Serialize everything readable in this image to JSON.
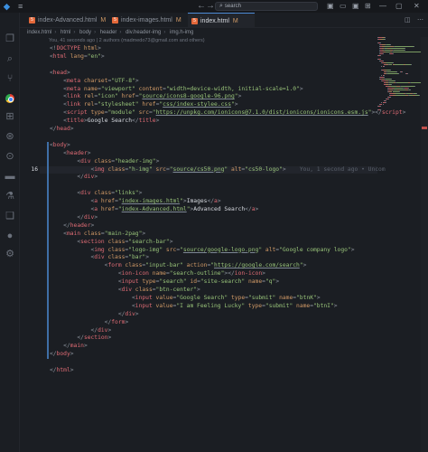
{
  "titlebar": {
    "menu_icon": "≡",
    "back": "←",
    "forward": "→",
    "search_icon": "⌕",
    "search_text": "search"
  },
  "tabs": [
    {
      "name": "index-Advanced.html",
      "status": "M",
      "active": false
    },
    {
      "name": "index-images.html",
      "status": "M",
      "active": false
    },
    {
      "name": "index.html",
      "status": "M",
      "active": true
    }
  ],
  "breadcrumb": [
    "index.html",
    "html",
    "body",
    "header",
    "div.header-img",
    "img.h-img"
  ],
  "blame": "You, 41 seconds ago | 2 authors (madmedo73@gmail.com and others)",
  "inline_blame": "You, 1 second ago • Uncom",
  "editor": {
    "active_line": 16,
    "lines": [
      [
        [
          "t-pun",
          "<!"
        ],
        [
          "t-tag",
          "DOCTYPE"
        ],
        [
          "t-attr",
          " html"
        ],
        [
          "t-pun",
          ">"
        ]
      ],
      [
        [
          "t-pun",
          "<"
        ],
        [
          "t-tag",
          "html"
        ],
        [
          "t-attr",
          " lang"
        ],
        [
          "t-pun",
          "="
        ],
        [
          "t-str",
          "\"en\""
        ],
        [
          "t-pun",
          ">"
        ]
      ],
      [],
      [
        [
          "t-pun",
          "<"
        ],
        [
          "t-tag",
          "head"
        ],
        [
          "t-pun",
          ">"
        ]
      ],
      [
        [
          "t-txt",
          "    "
        ],
        [
          "t-pun",
          "<"
        ],
        [
          "t-tag",
          "meta"
        ],
        [
          "t-attr",
          " charset"
        ],
        [
          "t-pun",
          "="
        ],
        [
          "t-str",
          "\"UTF-8\""
        ],
        [
          "t-pun",
          ">"
        ]
      ],
      [
        [
          "t-txt",
          "    "
        ],
        [
          "t-pun",
          "<"
        ],
        [
          "t-tag",
          "meta"
        ],
        [
          "t-attr",
          " name"
        ],
        [
          "t-pun",
          "="
        ],
        [
          "t-str",
          "\"viewport\""
        ],
        [
          "t-attr",
          " content"
        ],
        [
          "t-pun",
          "="
        ],
        [
          "t-str",
          "\"width=device-width, initial-scale=1.0\""
        ],
        [
          "t-pun",
          ">"
        ]
      ],
      [
        [
          "t-txt",
          "    "
        ],
        [
          "t-pun",
          "<"
        ],
        [
          "t-tag",
          "link"
        ],
        [
          "t-attr",
          " rel"
        ],
        [
          "t-pun",
          "="
        ],
        [
          "t-str",
          "\"icon\""
        ],
        [
          "t-attr",
          " href"
        ],
        [
          "t-pun",
          "="
        ],
        [
          "t-str",
          "\""
        ],
        [
          "t-str u",
          "source/icons8-google-96.png"
        ],
        [
          "t-str",
          "\""
        ],
        [
          "t-pun",
          ">"
        ]
      ],
      [
        [
          "t-txt",
          "    "
        ],
        [
          "t-pun",
          "<"
        ],
        [
          "t-tag",
          "link"
        ],
        [
          "t-attr",
          " rel"
        ],
        [
          "t-pun",
          "="
        ],
        [
          "t-str",
          "\"stylesheet\""
        ],
        [
          "t-attr",
          " href"
        ],
        [
          "t-pun",
          "="
        ],
        [
          "t-str",
          "\""
        ],
        [
          "t-str u",
          "css/index-stylee.css"
        ],
        [
          "t-str",
          "\""
        ],
        [
          "t-pun",
          ">"
        ]
      ],
      [
        [
          "t-txt",
          "    "
        ],
        [
          "t-pun",
          "<"
        ],
        [
          "t-tag",
          "script"
        ],
        [
          "t-attr",
          " type"
        ],
        [
          "t-pun",
          "="
        ],
        [
          "t-str",
          "\"module\""
        ],
        [
          "t-attr",
          " src"
        ],
        [
          "t-pun",
          "="
        ],
        [
          "t-str",
          "\""
        ],
        [
          "t-str u",
          "https://unpkg.com/ionicons@7.1.0/dist/ionicons/ionicons.esm.js"
        ],
        [
          "t-str",
          "\""
        ],
        [
          "t-pun",
          "></"
        ],
        [
          "t-tag",
          "script"
        ],
        [
          "t-pun",
          ">"
        ]
      ],
      [
        [
          "t-txt",
          "    "
        ],
        [
          "t-pun",
          "<"
        ],
        [
          "t-tag",
          "title"
        ],
        [
          "t-pun",
          ">"
        ],
        [
          "t-txt",
          "Google Search"
        ],
        [
          "t-pun",
          "</"
        ],
        [
          "t-tag",
          "title"
        ],
        [
          "t-pun",
          ">"
        ]
      ],
      [
        [
          "t-pun",
          "</"
        ],
        [
          "t-tag",
          "head"
        ],
        [
          "t-pun",
          ">"
        ]
      ],
      [],
      [
        [
          "t-pun",
          "<"
        ],
        [
          "t-tag",
          "body"
        ],
        [
          "t-pun",
          ">"
        ]
      ],
      [
        [
          "t-txt",
          "    "
        ],
        [
          "t-pun",
          "<"
        ],
        [
          "t-tag",
          "header"
        ],
        [
          "t-pun",
          ">"
        ]
      ],
      [
        [
          "t-txt",
          "        "
        ],
        [
          "t-pun",
          "<"
        ],
        [
          "t-tag",
          "div"
        ],
        [
          "t-attr",
          " class"
        ],
        [
          "t-pun",
          "="
        ],
        [
          "t-str",
          "\"header-img\""
        ],
        [
          "t-pun",
          ">"
        ]
      ],
      [
        [
          "t-txt",
          "            "
        ],
        [
          "t-pun",
          "<"
        ],
        [
          "t-tag",
          "img"
        ],
        [
          "t-attr",
          " class"
        ],
        [
          "t-pun",
          "="
        ],
        [
          "t-str",
          "\"h-img\""
        ],
        [
          "t-attr",
          " src"
        ],
        [
          "t-pun",
          "="
        ],
        [
          "t-str",
          "\""
        ],
        [
          "t-str u",
          "source/cs50.png"
        ],
        [
          "t-str",
          "\""
        ],
        [
          "t-attr",
          " alt"
        ],
        [
          "t-pun",
          "="
        ],
        [
          "t-str",
          "\"cs50-logo\""
        ],
        [
          "t-pun",
          ">"
        ],
        [
          "inline-blame",
          "    You, 1 second ago • Uncom"
        ]
      ],
      [
        [
          "t-txt",
          "        "
        ],
        [
          "t-pun",
          "</"
        ],
        [
          "t-tag",
          "div"
        ],
        [
          "t-pun",
          ">"
        ]
      ],
      [],
      [
        [
          "t-txt",
          "        "
        ],
        [
          "t-pun",
          "<"
        ],
        [
          "t-tag",
          "div"
        ],
        [
          "t-attr",
          " class"
        ],
        [
          "t-pun",
          "="
        ],
        [
          "t-str",
          "\"links\""
        ],
        [
          "t-pun",
          ">"
        ]
      ],
      [
        [
          "t-txt",
          "            "
        ],
        [
          "t-pun",
          "<"
        ],
        [
          "t-tag",
          "a"
        ],
        [
          "t-attr",
          " href"
        ],
        [
          "t-pun",
          "="
        ],
        [
          "t-str",
          "\""
        ],
        [
          "t-str u",
          "index-images.html"
        ],
        [
          "t-str",
          "\""
        ],
        [
          "t-pun",
          ">"
        ],
        [
          "t-txt",
          "Images"
        ],
        [
          "t-pun",
          "</"
        ],
        [
          "t-tag",
          "a"
        ],
        [
          "t-pun",
          ">"
        ]
      ],
      [
        [
          "t-txt",
          "            "
        ],
        [
          "t-pun",
          "<"
        ],
        [
          "t-tag",
          "a"
        ],
        [
          "t-attr",
          " href"
        ],
        [
          "t-pun",
          "="
        ],
        [
          "t-str",
          "\""
        ],
        [
          "t-str u",
          "index-Advanced.html"
        ],
        [
          "t-str",
          "\""
        ],
        [
          "t-pun",
          ">"
        ],
        [
          "t-txt",
          "Advanced Search"
        ],
        [
          "t-pun",
          "</"
        ],
        [
          "t-tag",
          "a"
        ],
        [
          "t-pun",
          ">"
        ]
      ],
      [
        [
          "t-txt",
          "        "
        ],
        [
          "t-pun",
          "</"
        ],
        [
          "t-tag",
          "div"
        ],
        [
          "t-pun",
          ">"
        ]
      ],
      [
        [
          "t-txt",
          "    "
        ],
        [
          "t-pun",
          "</"
        ],
        [
          "t-tag",
          "header"
        ],
        [
          "t-pun",
          ">"
        ]
      ],
      [
        [
          "t-txt",
          "    "
        ],
        [
          "t-pun",
          "<"
        ],
        [
          "t-tag",
          "main"
        ],
        [
          "t-attr",
          " class"
        ],
        [
          "t-pun",
          "="
        ],
        [
          "t-str",
          "\"main-2pag\""
        ],
        [
          "t-pun",
          ">"
        ]
      ],
      [
        [
          "t-txt",
          "        "
        ],
        [
          "t-pun",
          "<"
        ],
        [
          "t-tag",
          "section"
        ],
        [
          "t-attr",
          " class"
        ],
        [
          "t-pun",
          "="
        ],
        [
          "t-str",
          "\"search-bar\""
        ],
        [
          "t-pun",
          ">"
        ]
      ],
      [
        [
          "t-txt",
          "            "
        ],
        [
          "t-pun",
          "<"
        ],
        [
          "t-tag",
          "img"
        ],
        [
          "t-attr",
          " class"
        ],
        [
          "t-pun",
          "="
        ],
        [
          "t-str",
          "\"logo-img\""
        ],
        [
          "t-attr",
          " src"
        ],
        [
          "t-pun",
          "="
        ],
        [
          "t-str",
          "\""
        ],
        [
          "t-str u",
          "source/google-logo.png"
        ],
        [
          "t-str",
          "\""
        ],
        [
          "t-attr",
          " alt"
        ],
        [
          "t-pun",
          "="
        ],
        [
          "t-str",
          "\"Google company logo\""
        ],
        [
          "t-pun",
          ">"
        ]
      ],
      [
        [
          "t-txt",
          "            "
        ],
        [
          "t-pun",
          "<"
        ],
        [
          "t-tag",
          "div"
        ],
        [
          "t-attr",
          " class"
        ],
        [
          "t-pun",
          "="
        ],
        [
          "t-str",
          "\"bar\""
        ],
        [
          "t-pun",
          ">"
        ]
      ],
      [
        [
          "t-txt",
          "                "
        ],
        [
          "t-pun",
          "<"
        ],
        [
          "t-tag",
          "form"
        ],
        [
          "t-attr",
          " class"
        ],
        [
          "t-pun",
          "="
        ],
        [
          "t-str",
          "\"input-bar\""
        ],
        [
          "t-attr",
          " action"
        ],
        [
          "t-pun",
          "="
        ],
        [
          "t-str",
          "\""
        ],
        [
          "t-str u",
          "https://google.com/search"
        ],
        [
          "t-str",
          "\""
        ],
        [
          "t-pun",
          ">"
        ]
      ],
      [
        [
          "t-txt",
          "                    "
        ],
        [
          "t-pun",
          "<"
        ],
        [
          "t-tag",
          "ion-icon"
        ],
        [
          "t-attr",
          " name"
        ],
        [
          "t-pun",
          "="
        ],
        [
          "t-str",
          "\"search-outline\""
        ],
        [
          "t-pun",
          "></"
        ],
        [
          "t-tag",
          "ion-icon"
        ],
        [
          "t-pun",
          ">"
        ]
      ],
      [
        [
          "t-txt",
          "                    "
        ],
        [
          "t-pun",
          "<"
        ],
        [
          "t-tag",
          "input"
        ],
        [
          "t-attr",
          " type"
        ],
        [
          "t-pun",
          "="
        ],
        [
          "t-str",
          "\"search\""
        ],
        [
          "t-attr",
          " id"
        ],
        [
          "t-pun",
          "="
        ],
        [
          "t-str",
          "\"site-search\""
        ],
        [
          "t-attr",
          " name"
        ],
        [
          "t-pun",
          "="
        ],
        [
          "t-str",
          "\"q\""
        ],
        [
          "t-pun",
          ">"
        ]
      ],
      [
        [
          "t-txt",
          "                    "
        ],
        [
          "t-pun",
          "<"
        ],
        [
          "t-tag",
          "div"
        ],
        [
          "t-attr",
          " class"
        ],
        [
          "t-pun",
          "="
        ],
        [
          "t-str",
          "\"btn-center\""
        ],
        [
          "t-pun",
          ">"
        ]
      ],
      [
        [
          "t-txt",
          "                        "
        ],
        [
          "t-pun",
          "<"
        ],
        [
          "t-tag",
          "input"
        ],
        [
          "t-attr",
          " value"
        ],
        [
          "t-pun",
          "="
        ],
        [
          "t-str",
          "\"Google Search\""
        ],
        [
          "t-attr",
          " type"
        ],
        [
          "t-pun",
          "="
        ],
        [
          "t-str",
          "\"submit\""
        ],
        [
          "t-attr",
          " name"
        ],
        [
          "t-pun",
          "="
        ],
        [
          "t-str",
          "\"btnK\""
        ],
        [
          "t-pun",
          ">"
        ]
      ],
      [
        [
          "t-txt",
          "                        "
        ],
        [
          "t-pun",
          "<"
        ],
        [
          "t-tag",
          "input"
        ],
        [
          "t-attr",
          " value"
        ],
        [
          "t-pun",
          "="
        ],
        [
          "t-str",
          "\"I am Feeling Lucky\""
        ],
        [
          "t-attr",
          " type"
        ],
        [
          "t-pun",
          "="
        ],
        [
          "t-str",
          "\"submit\""
        ],
        [
          "t-attr",
          " name"
        ],
        [
          "t-pun",
          "="
        ],
        [
          "t-str",
          "\"btnI\""
        ],
        [
          "t-pun",
          ">"
        ]
      ],
      [
        [
          "t-txt",
          "                    "
        ],
        [
          "t-pun",
          "</"
        ],
        [
          "t-tag",
          "div"
        ],
        [
          "t-pun",
          ">"
        ]
      ],
      [
        [
          "t-txt",
          "                "
        ],
        [
          "t-pun",
          "</"
        ],
        [
          "t-tag",
          "form"
        ],
        [
          "t-pun",
          ">"
        ]
      ],
      [
        [
          "t-txt",
          "            "
        ],
        [
          "t-pun",
          "</"
        ],
        [
          "t-tag",
          "div"
        ],
        [
          "t-pun",
          ">"
        ]
      ],
      [
        [
          "t-txt",
          "        "
        ],
        [
          "t-pun",
          "</"
        ],
        [
          "t-tag",
          "section"
        ],
        [
          "t-pun",
          ">"
        ]
      ],
      [
        [
          "t-txt",
          "    "
        ],
        [
          "t-pun",
          "</"
        ],
        [
          "t-tag",
          "main"
        ],
        [
          "t-pun",
          ">"
        ]
      ],
      [
        [
          "t-pun",
          "</"
        ],
        [
          "t-tag",
          "body"
        ],
        [
          "t-pun",
          ">"
        ]
      ],
      [],
      [
        [
          "t-pun",
          "</"
        ],
        [
          "t-tag",
          "html"
        ],
        [
          "t-pun",
          ">"
        ]
      ]
    ]
  }
}
